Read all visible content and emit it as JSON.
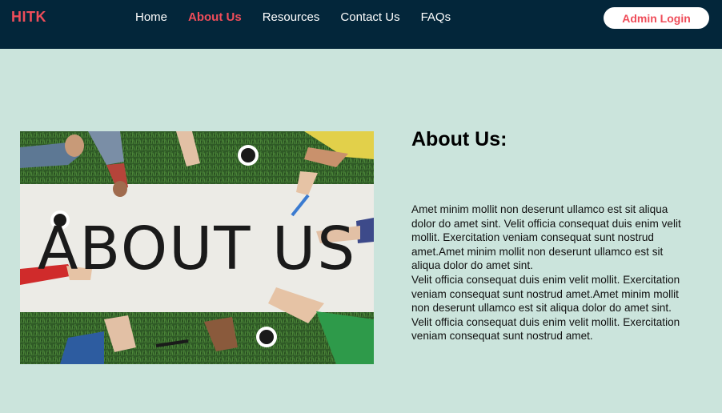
{
  "navbar": {
    "brand": "HITK",
    "links": [
      {
        "label": "Home",
        "active": false
      },
      {
        "label": "About Us",
        "active": true
      },
      {
        "label": "Resources",
        "active": false
      },
      {
        "label": "Contact Us",
        "active": false
      },
      {
        "label": "FAQs",
        "active": false
      }
    ],
    "admin_button": "Admin Login"
  },
  "hero_image": {
    "banner_text": "ABOUT US"
  },
  "about": {
    "heading": "About Us:",
    "paragraph_1": "Amet minim mollit non deserunt ullamco est sit aliqua dolor do amet sint. Velit officia consequat duis enim velit mollit. Exercitation veniam consequat sunt nostrud amet.Amet minim mollit non deserunt ullamco est sit aliqua dolor do amet sint.",
    "paragraph_2": "Velit officia consequat duis enim velit mollit. Exercitation veniam consequat sunt nostrud amet.Amet minim mollit non deserunt ullamco est sit aliqua dolor do amet sint. Velit officia consequat duis enim velit mollit. Exercitation veniam consequat sunt nostrud amet."
  },
  "colors": {
    "navbar_bg": "#03263a",
    "accent": "#ef4d5a",
    "page_bg": "#cbe4dc"
  }
}
